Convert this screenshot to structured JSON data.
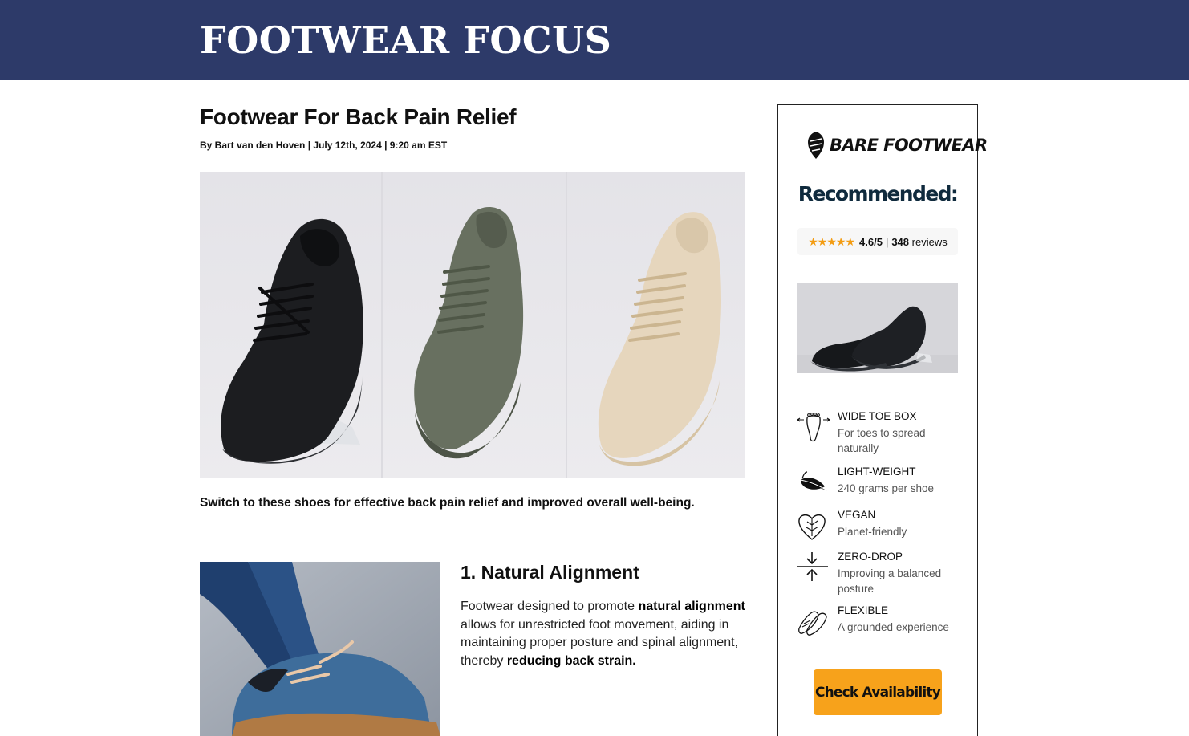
{
  "header": {
    "site_title": "FOOTWEAR FOCUS"
  },
  "article": {
    "headline": "Footwear For Back Pain Relief",
    "byline": "By Bart van den Hoven | July 12th, 2024 | 9:20 am EST",
    "intro": "Switch to these shoes for effective back pain relief and improved overall well-being.",
    "section1": {
      "title": "1. Natural Alignment",
      "body_parts": [
        "Footwear designed to promote ",
        "natural alignment",
        " allows for unrestricted foot movement, aiding in maintaining proper posture and spinal alignment, thereby ",
        "reducing back strain."
      ]
    }
  },
  "sidebar": {
    "brand": "BARE FOOTWEAR",
    "heading": "Recommended:",
    "rating": {
      "stars": "★★★★★",
      "score": "4.6/5",
      "separator": "|",
      "count": "348",
      "reviews_label": "reviews"
    },
    "features": [
      {
        "icon": "foot-icon",
        "title": "WIDE TOE BOX",
        "desc": "For toes to spread naturally"
      },
      {
        "icon": "feather-icon",
        "title": "LIGHT-WEIGHT",
        "desc": "240 grams per shoe"
      },
      {
        "icon": "leaf-heart-icon",
        "title": "VEGAN",
        "desc": "Planet-friendly"
      },
      {
        "icon": "arrows-converge-icon",
        "title": "ZERO-DROP",
        "desc": "Improving a balanced posture"
      },
      {
        "icon": "flexible-shoe-icon",
        "title": "FLEXIBLE",
        "desc": "A grounded experience"
      }
    ],
    "cta_label": "Check Availability"
  },
  "colors": {
    "header_bg": "#2d3a69",
    "cta_bg": "#f7a21b",
    "stars": "#f39c12",
    "heading": "#0f2a3d"
  }
}
